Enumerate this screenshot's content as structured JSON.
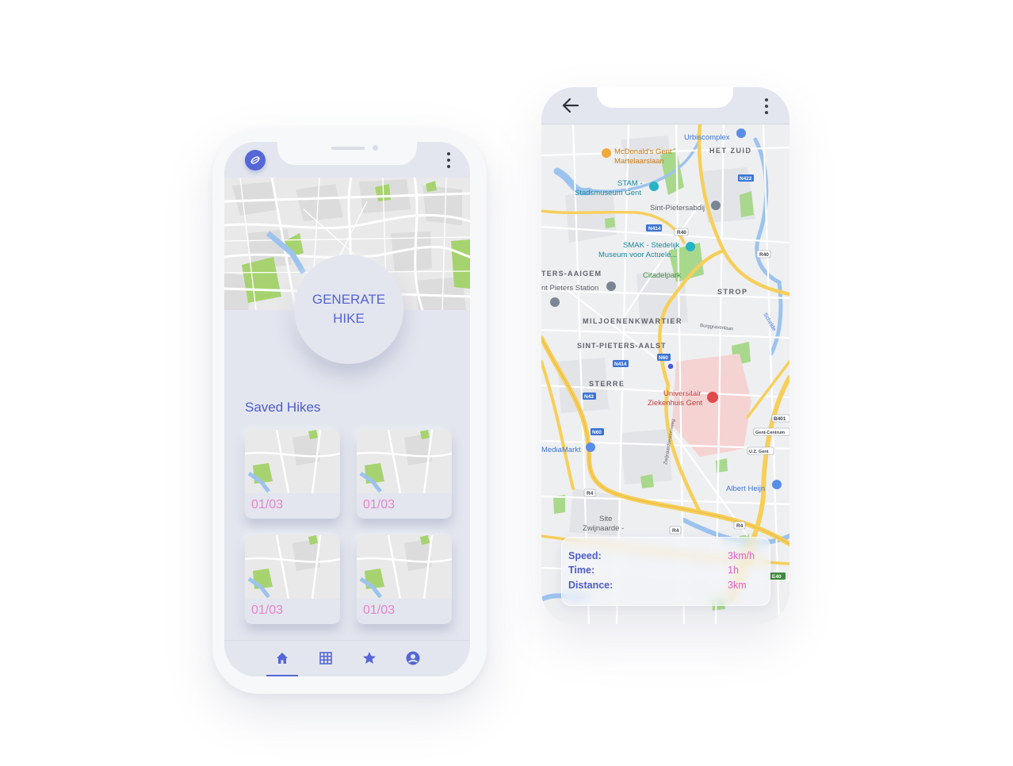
{
  "home_screen": {
    "generate_button": {
      "line1": "GENERATE",
      "line2": "HIKE"
    },
    "saved_hikes": {
      "title": "Saved Hikes",
      "cards": [
        {
          "date": "01/03"
        },
        {
          "date": "01/03"
        },
        {
          "date": "01/03"
        },
        {
          "date": "01/03"
        }
      ]
    },
    "bottom_nav": {
      "items": [
        "home-icon",
        "grid-icon",
        "star-icon",
        "account-icon"
      ],
      "active": "home-icon"
    }
  },
  "map_screen": {
    "labels": {
      "urbiscomplex": "Urbiscomplex",
      "mcdonalds1": "McDonald's Gent",
      "mcdonalds2": "Martelaarslaan",
      "het_zuid": "HET ZUID",
      "stam1": "STAM -",
      "stam2": "Stadsmuseum Gent",
      "sint_pietersabdij": "Sint-Pietersabdij",
      "smak1": "SMAK - Stedelijk",
      "smak2": "Museum voor Actuele...",
      "citadelpark": "Citadelpark",
      "strop": "STROP",
      "aaigem": "TERS-AAIGEM",
      "station": "nt Pieters Station",
      "miljoenenkwartier": "MILJOENENKWARTIER",
      "sint_pieters_aalst": "SINT-PIETERS-AALST",
      "sterre": "STERRE",
      "uz1": "Universitair",
      "uz2": "Ziekenhuis Gent",
      "mediamarkt": "MediaMarkt",
      "albert_heijn": "Albert Heijn",
      "site1": "Site",
      "site2": "Zwijnaarde -",
      "zwijnaardsesteenweg": "Zwijnaardsesteenweg",
      "burggravenlaan": "Burggravenlaan",
      "schelde": "Schelde",
      "n414a": "N414",
      "n414b": "N414",
      "r40a": "R40",
      "r40b": "R40",
      "n422": "N422",
      "n60a": "N60",
      "n60b": "N60",
      "n43": "N43",
      "r4a": "R4",
      "r4b": "R4",
      "r4c": "R4",
      "b401": "B401",
      "gent_centrum": "Gent-Centrum",
      "uz_gent": "U.Z. Gent",
      "e40": "E40"
    },
    "stats": {
      "speed_label": "Speed:",
      "speed_value": "3km/h",
      "time_label": "Time:",
      "time_value": "1h",
      "distance_label": "Distance:",
      "distance_value": "3km"
    }
  },
  "colors": {
    "accent": "#5566d6",
    "pink": "#e05fc9",
    "map_roads_major": "#f6cf5b",
    "map_park": "#9fd07d",
    "map_water": "#9cc3ee"
  }
}
